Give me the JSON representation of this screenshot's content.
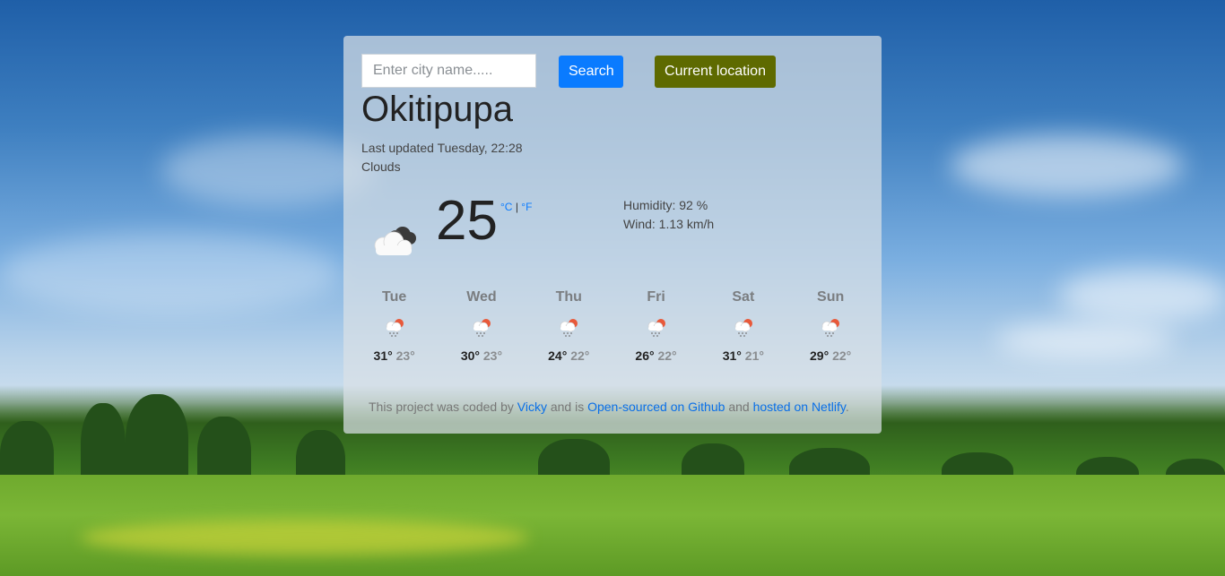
{
  "search": {
    "placeholder": "Enter city name.....",
    "search_label": "Search",
    "location_label": "Current location"
  },
  "current": {
    "city": "Okitipupa",
    "updated": "Last updated Tuesday, 22:28",
    "description": "Clouds",
    "temperature": "25",
    "unit_c": "°C",
    "unit_sep": "|",
    "unit_f": "°F",
    "humidity": "Humidity: 92 %",
    "wind": "Wind: 1.13 km/h",
    "icon": "cloudy-night-icon"
  },
  "forecast": [
    {
      "day": "Tue",
      "max": "31°",
      "min": "23°",
      "icon": "rain-icon"
    },
    {
      "day": "Wed",
      "max": "30°",
      "min": "23°",
      "icon": "rain-icon"
    },
    {
      "day": "Thu",
      "max": "24°",
      "min": "22°",
      "icon": "rain-icon"
    },
    {
      "day": "Fri",
      "max": "26°",
      "min": "22°",
      "icon": "rain-icon"
    },
    {
      "day": "Sat",
      "max": "31°",
      "min": "21°",
      "icon": "rain-icon"
    },
    {
      "day": "Sun",
      "max": "29°",
      "min": "22°",
      "icon": "rain-icon"
    }
  ],
  "footer": {
    "text1": "This project was coded by",
    "author": "Vicky",
    "text2": "and is",
    "github": "Open-sourced on Github",
    "text3": "and",
    "netlify": "hosted on Netlify",
    "text4": "."
  },
  "colors": {
    "primary": "#0a7bff",
    "location_button": "#5e6a00",
    "link": "#0a6fe8"
  }
}
